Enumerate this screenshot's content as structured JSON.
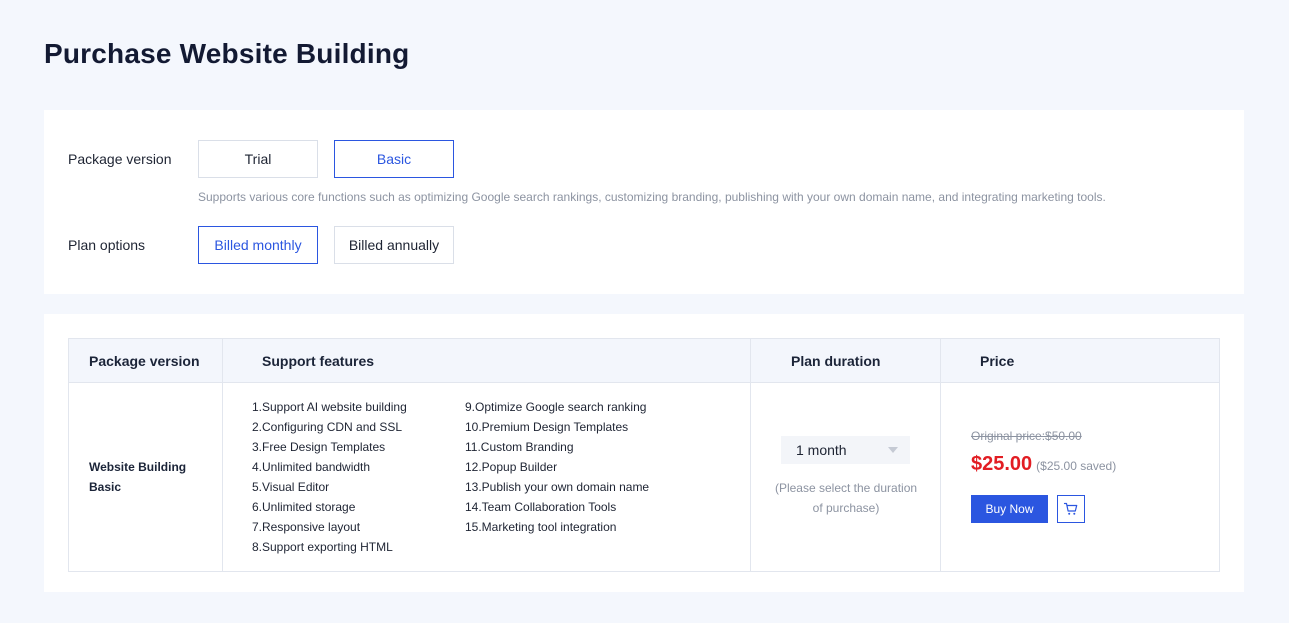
{
  "page": {
    "title": "Purchase Website Building"
  },
  "config": {
    "package_label": "Package version",
    "package_options": [
      "Trial",
      "Basic"
    ],
    "package_selected": "Basic",
    "package_description": "Supports various core functions such as optimizing Google search rankings, customizing branding, publishing with your own domain name, and integrating marketing tools.",
    "plan_label": "Plan options",
    "plan_options": [
      "Billed monthly",
      "Billed annually"
    ],
    "plan_selected": "Billed monthly"
  },
  "table": {
    "headers": [
      "Package version",
      "Support features",
      "Plan duration",
      "Price"
    ],
    "package_name": "Website Building Basic",
    "features_left": [
      "1.Support AI website building",
      "2.Configuring CDN and SSL",
      "3.Free Design Templates",
      "4.Unlimited bandwidth",
      "5.Visual Editor",
      "6.Unlimited storage",
      "7.Responsive layout",
      "8.Support exporting HTML"
    ],
    "features_right": [
      "9.Optimize Google search ranking",
      "10.Premium Design Templates",
      "11.Custom Branding",
      "12.Popup Builder",
      "13.Publish your own domain name",
      "14.Team Collaboration Tools",
      "15.Marketing tool integration"
    ],
    "duration_value": "1 month",
    "duration_hint": "(Please select the duration of purchase)",
    "original_price": "Original price:$50.00",
    "price": "$25.00",
    "saved": "($25.00 saved)",
    "buy_label": "Buy Now"
  },
  "colors": {
    "accent": "#2b56e0",
    "price_red": "#e21d23",
    "page_bg": "#f4f7fd"
  },
  "icons": {
    "cart": "cart-icon",
    "dropdown": "chevron-down-icon"
  }
}
